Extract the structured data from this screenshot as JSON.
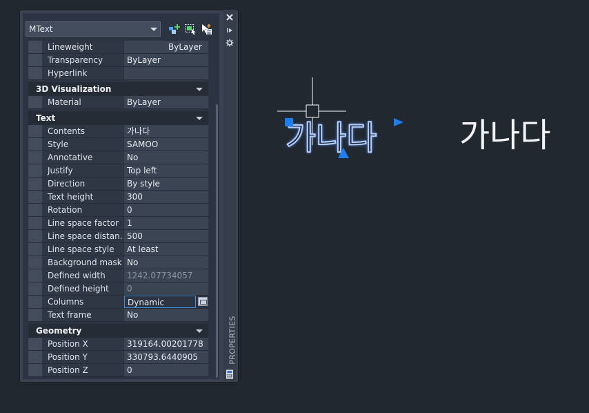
{
  "palette": {
    "title": "PROPERTIES",
    "object_type": "MText"
  },
  "properties": {
    "rows_top": [
      {
        "label": "Lineweight",
        "value": "ByLayer",
        "readonly": false
      },
      {
        "label": "Transparency",
        "value": "ByLayer",
        "readonly": false
      },
      {
        "label": "Hyperlink",
        "value": "",
        "readonly": false
      }
    ],
    "categories": [
      {
        "name": "3D Visualization",
        "rows": [
          {
            "label": "Material",
            "value": "ByLayer",
            "readonly": false
          }
        ]
      },
      {
        "name": "Text",
        "rows": [
          {
            "label": "Contents",
            "value": "가나다",
            "readonly": false
          },
          {
            "label": "Style",
            "value": "SAMOO",
            "readonly": false
          },
          {
            "label": "Annotative",
            "value": "No",
            "readonly": false
          },
          {
            "label": "Justify",
            "value": "Top left",
            "readonly": false
          },
          {
            "label": "Direction",
            "value": "By style",
            "readonly": false
          },
          {
            "label": "Text height",
            "value": "300",
            "readonly": false
          },
          {
            "label": "Rotation",
            "value": "0",
            "readonly": false
          },
          {
            "label": "Line space factor",
            "value": "1",
            "readonly": false
          },
          {
            "label": "Line space distan...",
            "value": "500",
            "readonly": false
          },
          {
            "label": "Line space style",
            "value": "At least",
            "readonly": false
          },
          {
            "label": "Background mask",
            "value": "No",
            "readonly": false
          },
          {
            "label": "Defined width",
            "value": "1242.07734057",
            "readonly": true
          },
          {
            "label": "Defined height",
            "value": "0",
            "readonly": true
          },
          {
            "label": "Columns",
            "value": "Dynamic",
            "readonly": false,
            "selected": true
          },
          {
            "label": "Text frame",
            "value": "No",
            "readonly": false
          }
        ]
      },
      {
        "name": "Geometry",
        "rows": [
          {
            "label": "Position X",
            "value": "319164.00201778",
            "readonly": false
          },
          {
            "label": "Position Y",
            "value": "330793.6440905",
            "readonly": false
          },
          {
            "label": "Position Z",
            "value": "0",
            "readonly": false
          }
        ]
      }
    ]
  },
  "canvas": {
    "selected_text": "가나다",
    "plain_text": "가나다"
  },
  "colors": {
    "canvas_bg": "#212830",
    "grip_blue": "#1e7ef0",
    "selection_glow": "#aac8ff"
  },
  "icons": [
    "quick-select-icon",
    "select-objects-icon",
    "toggle-pickadd-icon",
    "close-icon",
    "auto-hide-icon",
    "palette-settings-icon",
    "calculator-icon"
  ]
}
